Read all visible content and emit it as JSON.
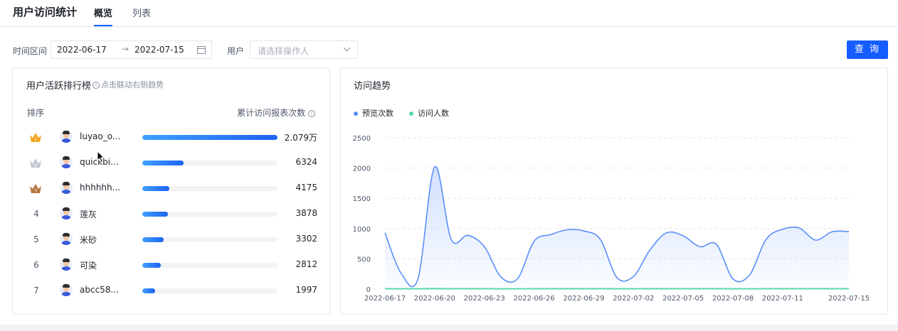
{
  "header": {
    "title": "用户访问统计",
    "tabs": [
      {
        "label": "概览",
        "active": true
      },
      {
        "label": "列表",
        "active": false
      }
    ]
  },
  "filters": {
    "time_label": "时间区间",
    "start_date": "2022-06-17",
    "end_date": "2022-07-15",
    "user_label": "用户",
    "user_placeholder": "请选择操作人",
    "query_button": "查 询"
  },
  "ranking": {
    "title": "用户活跃排行榜",
    "hint": "点击联动右侧趋势",
    "col_rank": "排序",
    "col_count": "累计访问报表次数",
    "rows": [
      {
        "rank": "1",
        "name": "luyao_o...",
        "count": "2.079万",
        "value": 20790,
        "medal": "gold"
      },
      {
        "rank": "2",
        "name": "quickbiu...",
        "count": "6324",
        "value": 6324,
        "medal": "silver"
      },
      {
        "rank": "3",
        "name": "hhhhhh...",
        "count": "4175",
        "value": 4175,
        "medal": "bronze"
      },
      {
        "rank": "4",
        "name": "莲灰",
        "count": "3878",
        "value": 3878,
        "medal": ""
      },
      {
        "rank": "5",
        "name": "米砂",
        "count": "3302",
        "value": 3302,
        "medal": ""
      },
      {
        "rank": "6",
        "name": "可染",
        "count": "2812",
        "value": 2812,
        "medal": ""
      },
      {
        "rank": "7",
        "name": "abcc58...",
        "count": "1997",
        "value": 1997,
        "medal": ""
      }
    ]
  },
  "trend": {
    "title": "访问趋势",
    "colors": {
      "views": "#5b8ff9",
      "visitors": "#5ad8a6"
    }
  },
  "chart_data": {
    "type": "line",
    "title": "访问趋势",
    "x": [
      "2022-06-17",
      "2022-06-18",
      "2022-06-19",
      "2022-06-20",
      "2022-06-21",
      "2022-06-22",
      "2022-06-23",
      "2022-06-24",
      "2022-06-25",
      "2022-06-26",
      "2022-06-27",
      "2022-06-28",
      "2022-06-29",
      "2022-06-30",
      "2022-07-01",
      "2022-07-02",
      "2022-07-03",
      "2022-07-04",
      "2022-07-05",
      "2022-07-06",
      "2022-07-07",
      "2022-07-08",
      "2022-07-09",
      "2022-07-10",
      "2022-07-11",
      "2022-07-12",
      "2022-07-13",
      "2022-07-14",
      "2022-07-15"
    ],
    "x_tick_labels": [
      "2022-06-17",
      "2022-06-20",
      "2022-06-23",
      "2022-06-26",
      "2022-06-29",
      "2022-07-02",
      "2022-07-05",
      "2022-07-08",
      "2022-07-11",
      "2022-07-15"
    ],
    "y_ticks": [
      0,
      500,
      1000,
      1500,
      2000,
      2500
    ],
    "ylim": [
      0,
      2500
    ],
    "legend_position": "top-left",
    "series": [
      {
        "name": "预览次数",
        "color": "#5b8ff9",
        "area": true,
        "values": [
          930,
          250,
          180,
          2020,
          820,
          890,
          700,
          200,
          170,
          790,
          900,
          980,
          960,
          820,
          190,
          210,
          650,
          930,
          880,
          700,
          740,
          170,
          230,
          820,
          990,
          1010,
          810,
          950,
          950
        ]
      },
      {
        "name": "访问人数",
        "color": "#5ad8a6",
        "area": false,
        "values": [
          6,
          5,
          5,
          8,
          6,
          6,
          6,
          5,
          5,
          6,
          6,
          6,
          6,
          6,
          5,
          5,
          6,
          6,
          6,
          6,
          6,
          5,
          5,
          6,
          6,
          6,
          6,
          6,
          6
        ]
      }
    ]
  }
}
